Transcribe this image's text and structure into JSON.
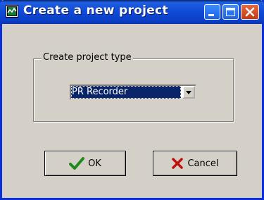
{
  "window": {
    "title": "Create a new project",
    "icon": "app-window-icon"
  },
  "titlebar_buttons": {
    "minimize": "minimize-icon",
    "maximize": "maximize-icon",
    "close": "close-icon"
  },
  "group": {
    "label": "Create project type",
    "project_type": {
      "selected": "PR Recorder"
    }
  },
  "buttons": {
    "ok_label": "OK",
    "ok_icon": "checkmark-icon",
    "cancel_label": "Cancel",
    "cancel_icon": "x-mark-icon"
  },
  "colors": {
    "titlebar": "#0f4ad6",
    "face": "#d4d0c8",
    "selection": "#0a246a",
    "ok_green": "#1e8a1e",
    "cancel_red": "#c01010"
  }
}
